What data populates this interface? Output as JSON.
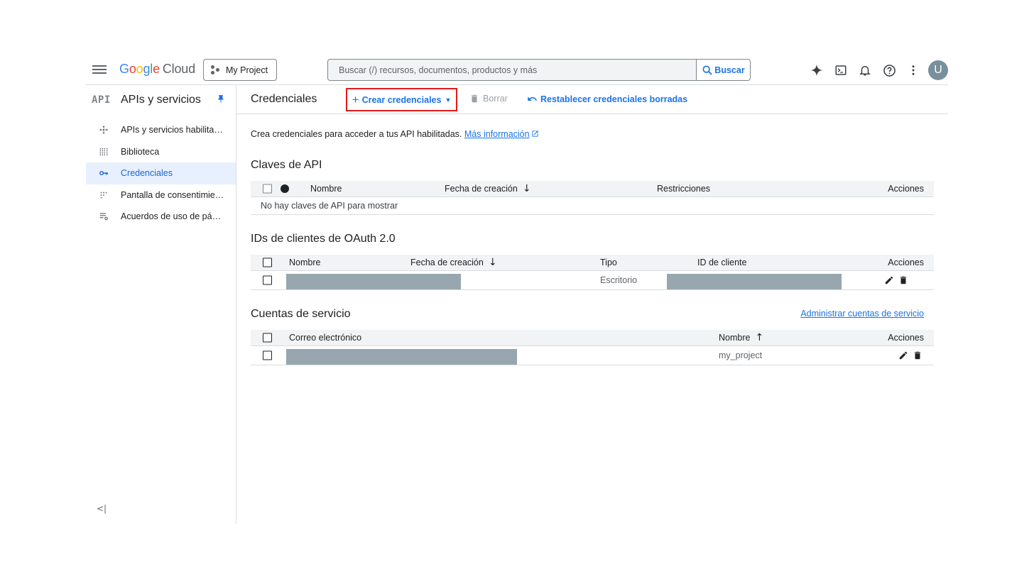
{
  "header": {
    "brand": {
      "g": "G",
      "o1": "o",
      "o2": "o",
      "g2": "g",
      "l": "l",
      "e": "e",
      "cloud": "Cloud"
    },
    "project_label": "My Project",
    "search_placeholder": "Buscar (/) recursos, documentos, productos y más",
    "search_button": "Buscar",
    "avatar_initial": "U",
    "icons": [
      "menu-icon",
      "gemini-icon",
      "cloud-shell-icon",
      "notifications-icon",
      "help-icon",
      "more-vert-icon"
    ]
  },
  "sidebar": {
    "logo_text": "API",
    "title": "APIs y servicios",
    "items": [
      {
        "label": "APIs y servicios habilitados",
        "icon": "enabled-apis-icon"
      },
      {
        "label": "Biblioteca",
        "icon": "library-icon"
      },
      {
        "label": "Credenciales",
        "icon": "key-icon",
        "active": true
      },
      {
        "label": "Pantalla de consentimiento de OAuth",
        "icon": "consent-icon"
      },
      {
        "label": "Acuerdos de uso de páginas",
        "icon": "agreements-icon"
      }
    ],
    "collapse_label": "<|"
  },
  "toolbar": {
    "title": "Credenciales",
    "create_label": "Crear credenciales",
    "delete_label": "Borrar",
    "restore_label": "Restablecer credenciales borradas"
  },
  "intro": {
    "text": "Crea credenciales para acceder a tus API habilitadas.",
    "link": "Más información"
  },
  "api_keys": {
    "title": "Claves de API",
    "columns": [
      "Nombre",
      "Fecha de creación",
      "Restricciones",
      "Acciones"
    ],
    "sort_arrow": "↓",
    "empty": "No hay claves de API para mostrar"
  },
  "oauth": {
    "title": "IDs de clientes de OAuth 2.0",
    "columns": [
      "Nombre",
      "Fecha de creación",
      "Tipo",
      "ID de cliente",
      "Acciones"
    ],
    "sort_arrow": "↓",
    "rows": [
      {
        "type": "Escritorio"
      }
    ]
  },
  "service_accounts": {
    "title": "Cuentas de servicio",
    "manage_link": "Administrar cuentas de servicio",
    "columns": [
      "Correo electrónico",
      "Nombre",
      "Acciones"
    ],
    "sort_arrow": "↑",
    "rows": [
      {
        "name": "my_project"
      }
    ]
  },
  "colors": {
    "accent": "#1a73e8",
    "highlight_border": "#e21b1b",
    "redaction": "#97a6af",
    "active_nav_bg": "#e8f0fe"
  }
}
